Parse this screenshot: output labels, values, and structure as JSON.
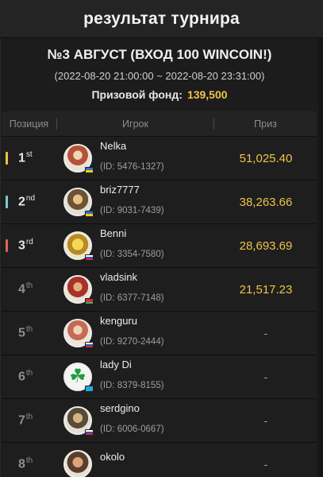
{
  "header": {
    "title": "результат турнира"
  },
  "tournament": {
    "name": "№3 АВГУСТ (ВХОД 100 WINCOIN!)",
    "time": "(2022-08-20 21:00:00 ~ 2022-08-20 23:31:00)",
    "prize_pool_label": "Призовой фонд:",
    "prize_pool_value": "139,500"
  },
  "table": {
    "columns": {
      "position": "Позиция",
      "player": "Игрок",
      "prize": "Приз"
    },
    "rows": [
      {
        "rank": "1",
        "suffix": "st",
        "name": "Nelka",
        "id": "(ID: 5476-1327)",
        "prize": "51,025.40",
        "flag": "ua",
        "marker": "#f0c24b"
      },
      {
        "rank": "2",
        "suffix": "nd",
        "name": "briz7777",
        "id": "(ID: 9031-7439)",
        "prize": "38,263.66",
        "flag": "ua",
        "marker": "#7fc9d8"
      },
      {
        "rank": "3",
        "suffix": "rd",
        "name": "Benni",
        "id": "(ID: 3354-7580)",
        "prize": "28,693.69",
        "flag": "ru",
        "marker": "#e0635a"
      },
      {
        "rank": "4",
        "suffix": "th",
        "name": "vladsink",
        "id": "(ID: 6377-7148)",
        "prize": "21,517.23",
        "flag": "by"
      },
      {
        "rank": "5",
        "suffix": "th",
        "name": "kenguru",
        "id": "(ID: 9270-2444)",
        "prize": "-",
        "flag": "ru"
      },
      {
        "rank": "6",
        "suffix": "th",
        "name": "lady Di",
        "id": "(ID: 8379-8155)",
        "prize": "-",
        "flag": "kz"
      },
      {
        "rank": "7",
        "suffix": "th",
        "name": "serdgino",
        "id": "(ID: 6006-0667)",
        "prize": "-",
        "flag": "ru"
      },
      {
        "rank": "8",
        "suffix": "th",
        "name": "okolo",
        "id": "",
        "prize": "-",
        "flag": ""
      }
    ]
  }
}
